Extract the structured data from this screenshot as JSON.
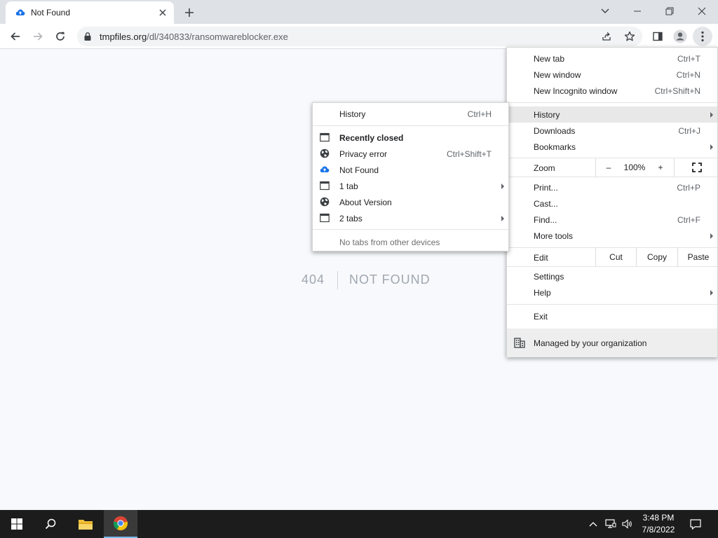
{
  "browser": {
    "tab": {
      "title": "Not Found"
    },
    "url": {
      "domain": "tmpfiles.org",
      "path": "/dl/340833/ransomwareblocker.exe"
    }
  },
  "page": {
    "code": "404",
    "message": "NOT FOUND"
  },
  "main_menu": {
    "new_tab": {
      "label": "New tab",
      "shortcut": "Ctrl+T"
    },
    "new_window": {
      "label": "New window",
      "shortcut": "Ctrl+N"
    },
    "new_incognito": {
      "label": "New Incognito window",
      "shortcut": "Ctrl+Shift+N"
    },
    "history": {
      "label": "History"
    },
    "downloads": {
      "label": "Downloads",
      "shortcut": "Ctrl+J"
    },
    "bookmarks": {
      "label": "Bookmarks"
    },
    "zoom": {
      "label": "Zoom",
      "minus": "–",
      "level": "100%",
      "plus": "+"
    },
    "print": {
      "label": "Print...",
      "shortcut": "Ctrl+P"
    },
    "cast": {
      "label": "Cast..."
    },
    "find": {
      "label": "Find...",
      "shortcut": "Ctrl+F"
    },
    "more_tools": {
      "label": "More tools"
    },
    "edit": {
      "label": "Edit",
      "cut": "Cut",
      "copy": "Copy",
      "paste": "Paste"
    },
    "settings": {
      "label": "Settings"
    },
    "help": {
      "label": "Help"
    },
    "exit": {
      "label": "Exit"
    },
    "managed": {
      "label": "Managed by your organization"
    }
  },
  "history_menu": {
    "history": {
      "label": "History",
      "shortcut": "Ctrl+H"
    },
    "recently_closed": "Recently closed",
    "items": [
      {
        "label": "Privacy error",
        "shortcut": "Ctrl+Shift+T",
        "icon": "globe-icon"
      },
      {
        "label": "Not Found",
        "icon": "cloud-upload-icon"
      },
      {
        "label": "1 tab",
        "icon": "tab-window-icon"
      },
      {
        "label": "About Version",
        "icon": "globe-icon"
      },
      {
        "label": "2 tabs",
        "icon": "tab-window-icon"
      }
    ],
    "no_tabs": "No tabs from other devices"
  },
  "taskbar": {
    "time": "3:48 PM",
    "date": "7/8/2022"
  },
  "colors": {
    "accent": "#1a73e8",
    "taskbar": "#1c1c1c"
  }
}
